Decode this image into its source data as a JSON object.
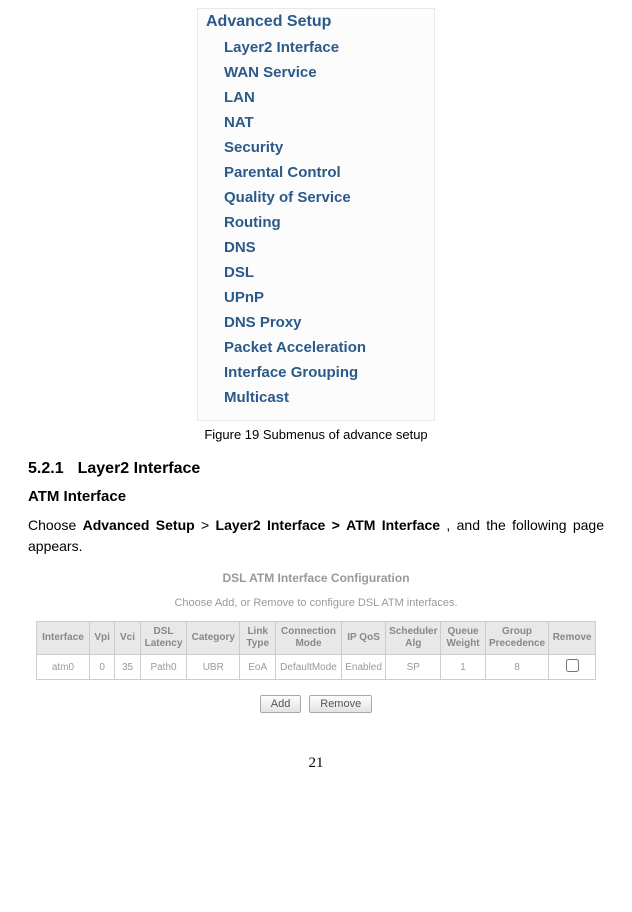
{
  "menu": {
    "title": "Advanced Setup",
    "items": [
      "Layer2 Interface",
      "WAN Service",
      "LAN",
      "NAT",
      "Security",
      "Parental Control",
      "Quality of Service",
      "Routing",
      "DNS",
      "DSL",
      "UPnP",
      "DNS Proxy",
      "Packet Acceleration",
      "Interface Grouping",
      "Multicast"
    ]
  },
  "figure_caption": "Figure 19 Submenus of advance setup",
  "section": {
    "number": "5.2.1",
    "title": "Layer2 Interface"
  },
  "subheading": "ATM Interface",
  "paragraph": {
    "p1": "Choose ",
    "b1": "Advanced Setup",
    "p2": " > ",
    "b2": "Layer2 Interface >",
    "p3": " ",
    "b3": "ATM Interface",
    "p4": " , and the following page appears."
  },
  "config": {
    "title": "DSL ATM Interface Configuration",
    "subtitle": "Choose Add, or Remove to configure DSL ATM interfaces.",
    "headers": [
      "Interface",
      "Vpi",
      "Vci",
      "DSL Latency",
      "Category",
      "Link Type",
      "Connection Mode",
      "IP QoS",
      "Scheduler Alg",
      "Queue Weight",
      "Group Precedence",
      "Remove"
    ],
    "row": {
      "interface": "atm0",
      "vpi": "0",
      "vci": "35",
      "latency": "Path0",
      "category": "UBR",
      "linktype": "EoA",
      "connmode": "DefaultMode",
      "ipqos": "Enabled",
      "sched": "SP",
      "qweight": "1",
      "gprec": "8"
    },
    "buttons": {
      "add": "Add",
      "remove": "Remove"
    }
  },
  "page_number": "21"
}
